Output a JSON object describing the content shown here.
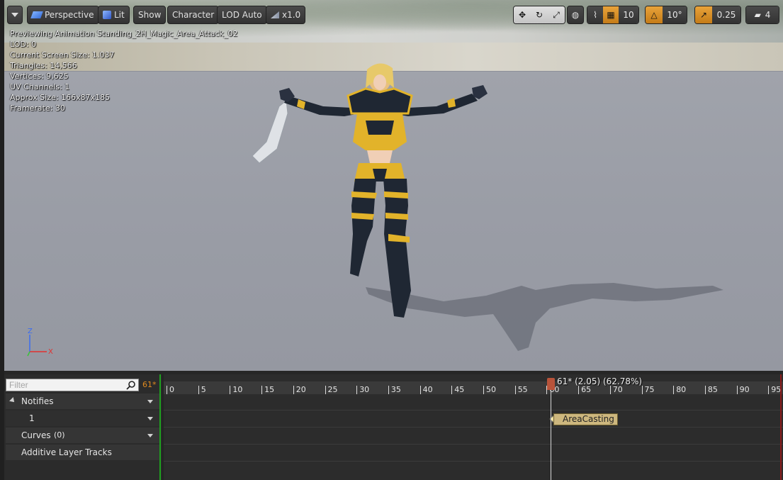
{
  "toolbar": {
    "menu_icon": "chevron-down-icon",
    "perspective_label": "Perspective",
    "lit_label": "Lit",
    "show_label": "Show",
    "character_label": "Character",
    "lod_label": "LOD Auto",
    "speed_label": "x1.0",
    "grid_snap_value": "10",
    "rotation_snap_value": "10°",
    "scale_snap_value": "0.25",
    "camera_speed_value": "4"
  },
  "stats": {
    "line1": "Previewing Animation Standing_2H_Magic_Area_Attack_02",
    "line2": "LOD: 0",
    "line3": "Current Screen Size: 1.037",
    "line4": "Triangles: 14,566",
    "line5": "Vertices: 9,625",
    "line6": "UV Channels: 1",
    "line7": "Approx Size: 166x87x185",
    "line8": "Framerate: 30"
  },
  "axis": {
    "z": "Z",
    "x": "X"
  },
  "tracks": {
    "filter_placeholder": "Filter",
    "frame_count": "61*",
    "notifies_label": "Notifies",
    "notify_track_label": "1",
    "curves_label": "Curves",
    "curves_count": "(0)",
    "additive_label": "Additive Layer Tracks"
  },
  "timeline": {
    "ticks": [
      "0",
      "5",
      "10",
      "15",
      "20",
      "25",
      "30",
      "35",
      "40",
      "45",
      "50",
      "55",
      "60",
      "65",
      "70",
      "75",
      "80",
      "85",
      "90",
      "95"
    ],
    "playhead_label": "61* (2.05) (62.78%)",
    "notify_name": "AreaCasting"
  },
  "colors": {
    "accent_orange": "#e08a1e",
    "playhead": "#b8533a",
    "notify": "#cdb77e"
  }
}
